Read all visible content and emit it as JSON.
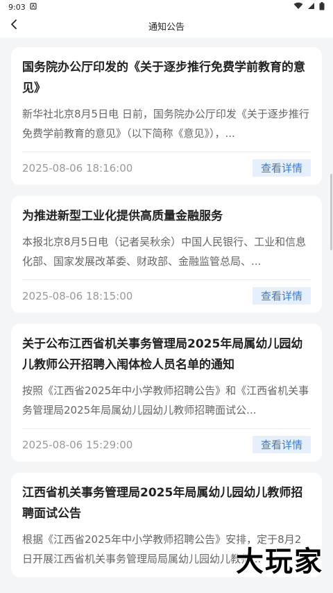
{
  "status": {
    "time": "9:03"
  },
  "header": {
    "title": "通知公告"
  },
  "articles": [
    {
      "title": "国务院办公厅印发的《关于逐步推行免费学前教育的意见》",
      "summary": "新华社北京8月5日电 日前，国务院办公厅印发《关于逐步推行免费学前教育的意见》（以下简称《意见》），...",
      "date": "2025-08-06 18:16:00",
      "action": "查看详情"
    },
    {
      "title": "为推进新型工业化提供高质量金融服务",
      "summary": "本报北京8月5日电（记者吴秋余）中国人民银行、工业和信息化部、国家发展改革委、财政部、金融监管总局、...",
      "date": "2025-08-06 18:15:00",
      "action": "查看详情"
    },
    {
      "title": "关于公布江西省机关事务管理局2025年局属幼儿园幼儿教师公开招聘入闱体检人员名单的通知",
      "summary": "按照《江西省2025年中小学教师招聘公告》和《江西省机关事务管理局2025年局属幼儿园幼儿教师招聘面试公...",
      "date": "2025-08-06 15:29:00",
      "action": "查看详情"
    },
    {
      "title": "江西省机关事务管理局2025年局属幼儿园幼儿教师招聘面试公告",
      "summary": "根据《江西省2025年中小学教师招聘公告》安排，定于8月2日开展江西省机关事务管理局局属幼儿园幼儿教师...",
      "date": "",
      "action": ""
    }
  ],
  "watermark": "大玩家"
}
